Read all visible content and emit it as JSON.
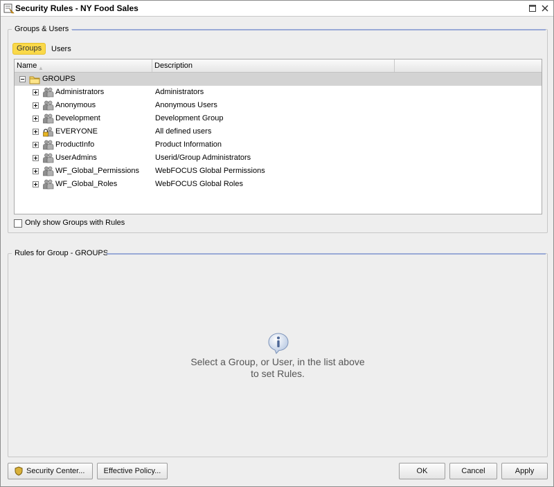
{
  "window": {
    "title": "Security Rules - NY Food Sales",
    "icons": [
      "security-rules-icon",
      "maximize-icon",
      "close-icon"
    ]
  },
  "groups_users": {
    "title": "Groups & Users",
    "tabs": {
      "groups": "Groups",
      "users": "Users"
    },
    "active_tab": "Groups",
    "columns": {
      "name": "Name",
      "description": "Description",
      "extra": ""
    },
    "root": {
      "name": "GROUPS",
      "icon": "folder-icon",
      "expanded": true
    },
    "groups": [
      {
        "name": "Administrators",
        "description": "Administrators",
        "icon": "group-icon"
      },
      {
        "name": "Anonymous",
        "description": "Anonymous Users",
        "icon": "group-icon"
      },
      {
        "name": "Development",
        "description": "Development Group",
        "icon": "group-icon"
      },
      {
        "name": "EVERYONE",
        "description": "All defined users",
        "icon": "locked-group-icon"
      },
      {
        "name": "ProductInfo",
        "description": "Product Information",
        "icon": "group-icon"
      },
      {
        "name": "UserAdmins",
        "description": "Userid/Group Administrators",
        "icon": "group-icon"
      },
      {
        "name": "WF_Global_Permissions",
        "description": "WebFOCUS Global Permissions",
        "icon": "group-icon"
      },
      {
        "name": "WF_Global_Roles",
        "description": "WebFOCUS Global Roles",
        "icon": "group-icon"
      }
    ],
    "only_rules_checkbox": {
      "label": "Only show Groups with Rules",
      "checked": false
    }
  },
  "rules": {
    "title": "Rules for Group - GROUPS",
    "info_line1": "Select a Group, or User, in the list above",
    "info_line2": "to set Rules."
  },
  "footer": {
    "security_center": "Security Center...",
    "effective_policy": "Effective Policy...",
    "ok": "OK",
    "cancel": "Cancel",
    "apply": "Apply"
  },
  "colors": {
    "active_tab": "#fad94a",
    "root_row": "#d3d3d3",
    "group_line": "#99a9d6"
  }
}
